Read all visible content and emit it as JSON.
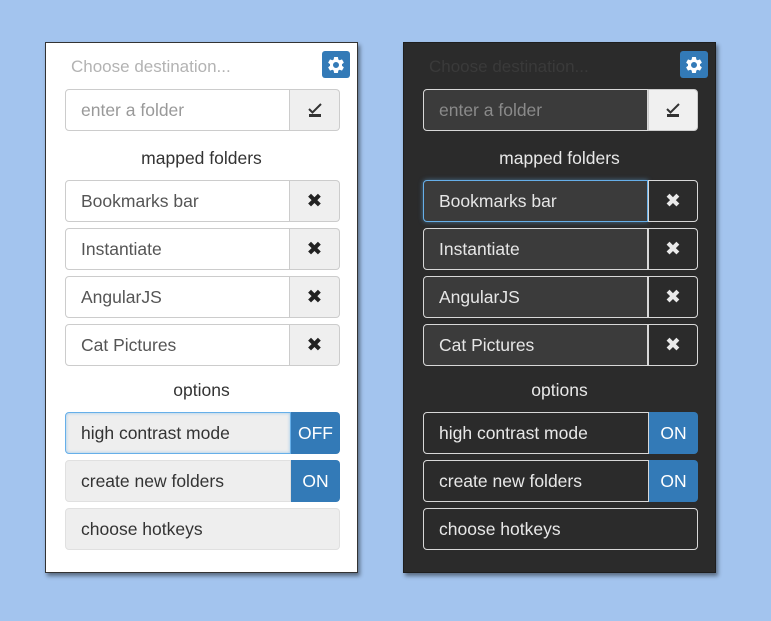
{
  "light": {
    "placeholder_text": "Choose destination...",
    "folder_input_placeholder": "enter a folder",
    "mapped_title": "mapped folders",
    "folders": [
      {
        "label": "Bookmarks bar"
      },
      {
        "label": "Instantiate"
      },
      {
        "label": "AngularJS"
      },
      {
        "label": "Cat Pictures"
      }
    ],
    "remove_glyph": "✖",
    "options_title": "options",
    "options": {
      "high_contrast": {
        "label": "high contrast mode",
        "state": "OFF"
      },
      "create_folders": {
        "label": "create new folders",
        "state": "ON"
      },
      "hotkeys": {
        "label": "choose hotkeys"
      }
    }
  },
  "dark": {
    "placeholder_text": "Choose destination...",
    "folder_input_placeholder": "enter a folder",
    "mapped_title": "mapped folders",
    "folders": [
      {
        "label": "Bookmarks bar"
      },
      {
        "label": "Instantiate"
      },
      {
        "label": "AngularJS"
      },
      {
        "label": "Cat Pictures"
      }
    ],
    "remove_glyph": "✖",
    "options_title": "options",
    "options": {
      "high_contrast": {
        "label": "high contrast mode",
        "state": "ON"
      },
      "create_folders": {
        "label": "create new folders",
        "state": "ON"
      },
      "hotkeys": {
        "label": "choose hotkeys"
      }
    }
  },
  "colors": {
    "background": "#a3c4ee",
    "accent": "#337ab7",
    "focus": "#66afe9",
    "dark_panel": "#2b2b2b"
  },
  "icons": {
    "settings": "gear-icon",
    "confirm": "checkmark-icon",
    "remove": "close-icon"
  }
}
